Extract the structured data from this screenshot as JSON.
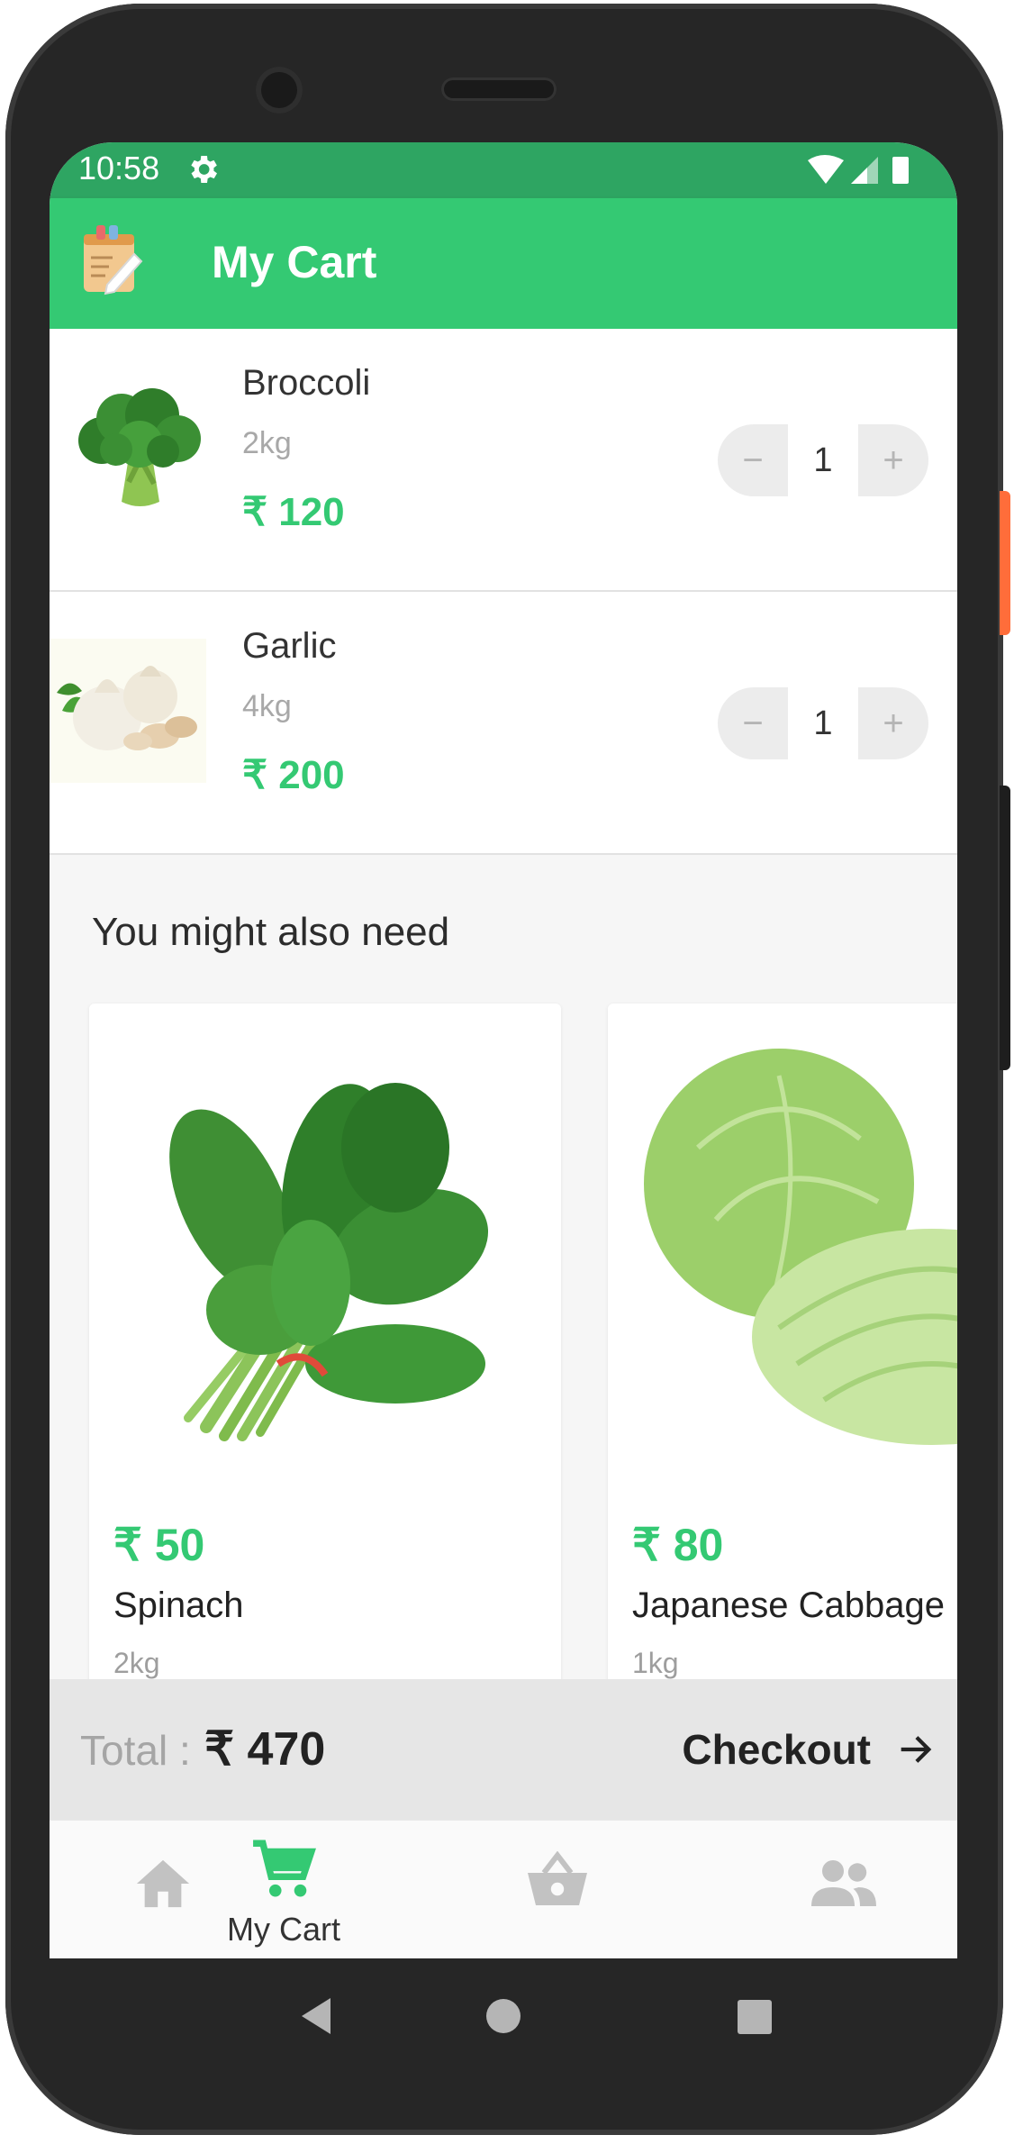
{
  "status_bar": {
    "time": "10:58"
  },
  "app_bar": {
    "title": "My Cart"
  },
  "cart_items": [
    {
      "name": "Broccoli",
      "weight": "2kg",
      "price": "₹ 120",
      "quantity": "1"
    },
    {
      "name": "Garlic",
      "weight": "4kg",
      "price": "₹ 200",
      "quantity": "1"
    }
  ],
  "stepper": {
    "minus": "−",
    "plus": "+"
  },
  "suggestions": {
    "title": "You might also need",
    "items": [
      {
        "price": "₹ 50",
        "name": "Spinach",
        "weight": "2kg"
      },
      {
        "price": "₹ 80",
        "name": "Japanese Cabbage",
        "weight": "1kg"
      }
    ]
  },
  "total_bar": {
    "label": "Total :",
    "value": "₹ 470",
    "checkout_label": "Checkout"
  },
  "bottom_nav": {
    "items": [
      {
        "icon": "home-icon",
        "active": false
      },
      {
        "icon": "cart-icon",
        "label": "My Cart",
        "active": true
      },
      {
        "icon": "basket-icon",
        "active": false
      },
      {
        "icon": "people-icon",
        "active": false
      }
    ]
  },
  "colors": {
    "accent": "#34c973",
    "status_bar": "#2ea562",
    "inactive_icon": "#c2c2c2"
  }
}
